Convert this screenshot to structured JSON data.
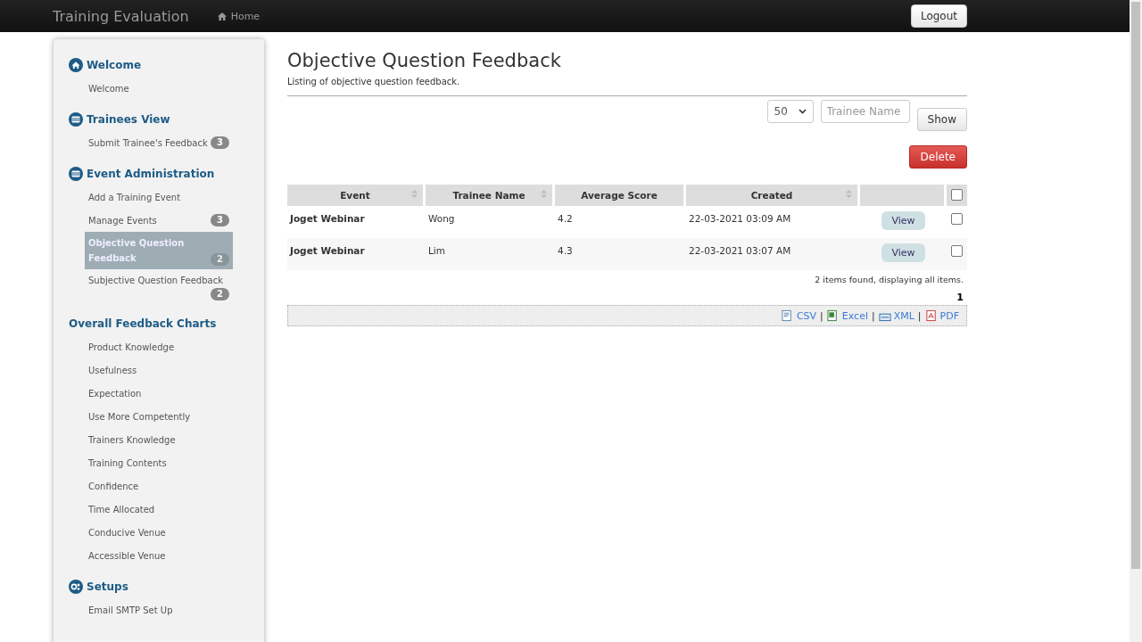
{
  "navbar": {
    "brand": "Training Evaluation",
    "links": [
      {
        "label": "Home"
      }
    ],
    "logout": "Logout"
  },
  "sidebar": {
    "sections": [
      {
        "title": "Welcome",
        "items": [
          {
            "label": "Welcome",
            "selected": false
          }
        ]
      },
      {
        "title": "Trainees View",
        "items": [
          {
            "label": "Submit Trainee's Feedback",
            "badge": "3",
            "selected": false
          }
        ]
      },
      {
        "title": "Event Administration",
        "items": [
          {
            "label": "Add a Training Event",
            "selected": false
          },
          {
            "label": "Manage Events",
            "badge": "3",
            "selected": false
          },
          {
            "label": "Objective Question Feedback",
            "badge": "2",
            "selected": true
          },
          {
            "label": "Subjective Question Feedback",
            "badge": "2",
            "selected": false
          }
        ]
      },
      {
        "title": "Overall Feedback Charts",
        "items": [
          {
            "label": "Product Knowledge",
            "selected": false
          },
          {
            "label": "Usefulness",
            "selected": false
          },
          {
            "label": "Expectation",
            "selected": false
          },
          {
            "label": "Use More Competently",
            "selected": false
          },
          {
            "label": "Trainers Knowledge",
            "selected": false
          },
          {
            "label": "Training Contents",
            "selected": false
          },
          {
            "label": "Confidence",
            "selected": false
          },
          {
            "label": "Time Allocated",
            "selected": false
          },
          {
            "label": "Conducive Venue",
            "selected": false
          },
          {
            "label": "Accessible Venue",
            "selected": false
          }
        ]
      },
      {
        "title": "Setups",
        "items": [
          {
            "label": "Email SMTP Set Up",
            "selected": false
          }
        ]
      }
    ]
  },
  "page": {
    "title": "Objective Question Feedback",
    "subtitle": "Listing of objective question feedback."
  },
  "filters": {
    "page_size": "50",
    "search": {
      "placeholder": "Trainee Name"
    },
    "show": "Show"
  },
  "delete": "Delete",
  "table": {
    "columns": [
      {
        "label": "Event",
        "sortable": true
      },
      {
        "label": "Trainee Name",
        "sortable": true
      },
      {
        "label": "Average Score",
        "sortable": false
      },
      {
        "label": "Created",
        "sortable": true
      },
      {
        "sortable": false
      }
    ],
    "select_all": {
      "checked": false
    },
    "rows": [
      {
        "event": "Joget Webinar",
        "trainee": "Wong",
        "score": "4.2",
        "created": "22-03-2021 03:09 AM",
        "action": "View",
        "checked": false
      },
      {
        "event": "Joget Webinar",
        "trainee": "Lim",
        "score": "4.3",
        "created": "22-03-2021 03:07 AM",
        "action": "View",
        "checked": false
      }
    ]
  },
  "summary": "2 items found, displaying all items.",
  "pages": [
    "1"
  ],
  "export_separator": "|",
  "exports": [
    {
      "kind": "csv",
      "label": "CSV"
    },
    {
      "kind": "excel",
      "label": "Excel"
    },
    {
      "kind": "xml",
      "label": "XML"
    },
    {
      "kind": "pdf",
      "label": "PDF"
    }
  ]
}
